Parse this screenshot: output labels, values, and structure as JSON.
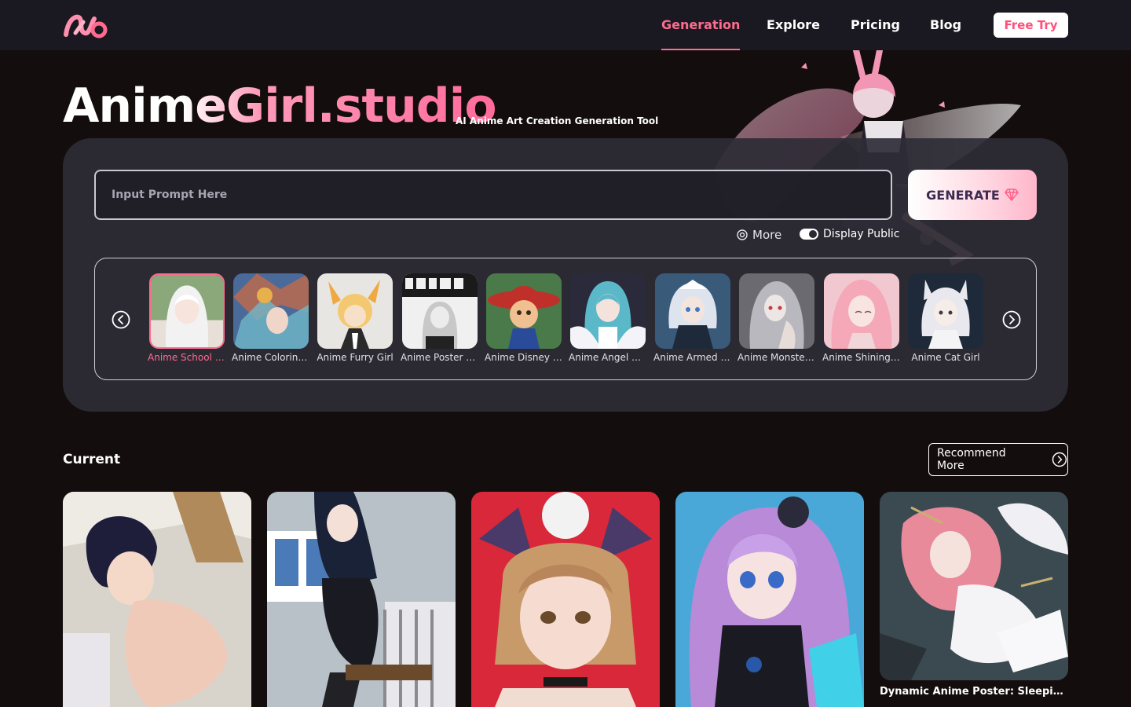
{
  "nav": {
    "links": [
      "Generation",
      "Explore",
      "Pricing",
      "Blog"
    ],
    "active": "Generation",
    "free_try": "Free Try"
  },
  "hero": {
    "brand": "AnimeGirl.studio",
    "tagline": "AI Anime Art Creation Generation Tool"
  },
  "prompt": {
    "placeholder": "Input Prompt Here",
    "generate_label": "GENERATE",
    "more_label": "More",
    "display_public_label": "Display Public"
  },
  "styles": {
    "selected": "Anime School Girl",
    "items": [
      {
        "label": "Anime School Girl"
      },
      {
        "label": "Anime Coloring ..."
      },
      {
        "label": "Anime Furry Girl"
      },
      {
        "label": "Anime Poster Girl"
      },
      {
        "label": "Anime Disney Girl"
      },
      {
        "label": "Anime Angel Girl"
      },
      {
        "label": "Anime Armed Girl"
      },
      {
        "label": "Anime Monster ..."
      },
      {
        "label": "Anime Shining Girl"
      },
      {
        "label": "Anime Cat Girl"
      }
    ]
  },
  "current": {
    "title": "Current",
    "recommend_label": "Recommend More",
    "cards": [
      {
        "caption": ""
      },
      {
        "caption": ""
      },
      {
        "caption": ""
      },
      {
        "caption": ""
      },
      {
        "caption": "Dynamic Anime Poster: Sleeping A..."
      }
    ]
  },
  "colors": {
    "accent": "#ff6b8f",
    "background": "#140d0d",
    "panel": "#2e2c36",
    "nav": "#1a1820"
  }
}
